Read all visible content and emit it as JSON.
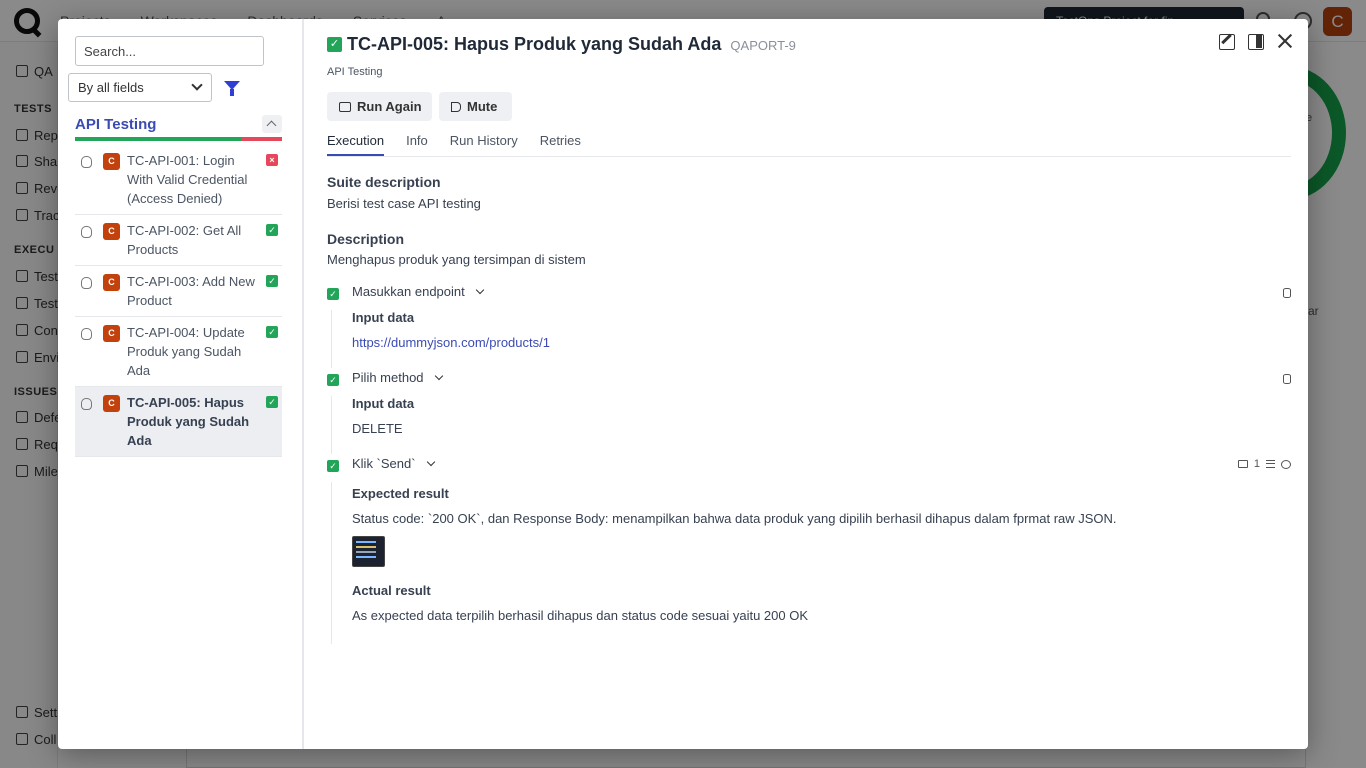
{
  "background": {
    "top_nav": [
      "Projects",
      "Workspaces",
      "Dashboards",
      "Services",
      "A"
    ],
    "project_button": "TestOps Project for fin",
    "avatar_letter": "C",
    "sidebar": {
      "project_abbr": "QA",
      "sections": [
        {
          "heading": "TESTS",
          "items": [
            "Rep",
            "Sha",
            "Revi",
            "Trac"
          ]
        },
        {
          "heading": "EXECU",
          "items": [
            "Test",
            "Test",
            "Con",
            "Envi"
          ]
        },
        {
          "heading": "ISSUES",
          "items": [
            "Defe",
            "Req",
            "Mile"
          ]
        }
      ],
      "footer": [
        "Sett",
        "Coll"
      ]
    },
    "ring_text": "e",
    "side_text": "ar"
  },
  "left_panel": {
    "search_placeholder": "Search...",
    "filter_select": "By all fields",
    "suite_title": "API Testing",
    "progress": {
      "passed_fraction": 0.8,
      "failed_fraction": 0.2
    },
    "cases": [
      {
        "badge": "C",
        "title": "TC-API-001: Login With Valid Credential (Access Denied)",
        "status": "failed",
        "active": false
      },
      {
        "badge": "C",
        "title": "TC-API-002: Get All Products",
        "status": "passed",
        "active": false
      },
      {
        "badge": "C",
        "title": "TC-API-003: Add New Product",
        "status": "passed",
        "active": false
      },
      {
        "badge": "C",
        "title": "TC-API-004: Update Produk yang Sudah Ada",
        "status": "passed",
        "active": false
      },
      {
        "badge": "C",
        "title": "TC-API-005: Hapus Produk yang Sudah Ada",
        "status": "passed",
        "active": true
      }
    ]
  },
  "detail": {
    "title": "TC-API-005: Hapus Produk yang Sudah Ada",
    "key": "QAPORT-9",
    "suite": "API Testing",
    "run_again": "Run Again",
    "mute": "Mute",
    "tabs": [
      "Execution",
      "Info",
      "Run History",
      "Retries"
    ],
    "suite_description_heading": "Suite description",
    "suite_description": "Berisi test case API testing",
    "description_heading": "Description",
    "description": "Menghapus produk yang tersimpan di sistem",
    "steps": [
      {
        "label": "Masukkan endpoint",
        "body_heading": "Input data",
        "body_text": "https://dummyjson.com/products/1"
      },
      {
        "label": "Pilih method",
        "body_heading": "Input data",
        "body_text": "DELETE"
      },
      {
        "label": "Klik `Send`",
        "attachments_count": "1",
        "expected_heading": "Expected result",
        "expected_text": "Status code: `200 OK`, dan Response Body: menampilkan bahwa data produk yang dipilih berhasil dihapus dalam fprmat raw JSON.",
        "actual_heading": "Actual result",
        "actual_text": "As expected data terpilih berhasil dihapus dan status code sesuai yaitu 200 OK"
      }
    ]
  }
}
